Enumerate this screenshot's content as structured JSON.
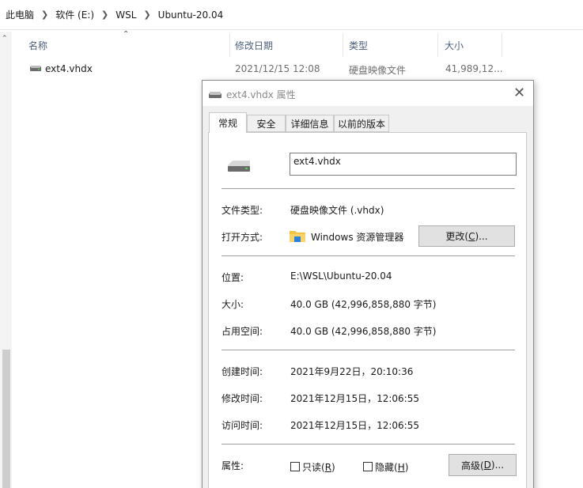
{
  "breadcrumb": [
    "此电脑",
    "软件 (E:)",
    "WSL",
    "Ubuntu-20.04"
  ],
  "list": {
    "columns": [
      "名称",
      "修改日期",
      "类型",
      "大小"
    ],
    "file": {
      "name": "ext4.vhdx",
      "modified": "2021/12/15 12:08",
      "type": "硬盘映像文件",
      "size": "41,989,12..."
    }
  },
  "dialog": {
    "title": "ext4.vhdx 属性",
    "tabs": [
      "常规",
      "安全",
      "详细信息",
      "以前的版本"
    ],
    "filename": "ext4.vhdx",
    "file_type_label": "文件类型:",
    "file_type_value": "硬盘映像文件 (.vhdx)",
    "open_with_label": "打开方式:",
    "open_with_value": "Windows 资源管理器",
    "change_button": {
      "text": "更改(",
      "key": "C",
      "rest": ")..."
    },
    "location_label": "位置:",
    "location_value": "E:\\WSL\\Ubuntu-20.04",
    "size_label": "大小:",
    "size_value": "40.0 GB (42,996,858,880 字节)",
    "disk_size_label": "占用空间:",
    "disk_size_value": "40.0 GB (42,996,858,880 字节)",
    "created_label": "创建时间:",
    "created_value": "2021年9月22日，20:10:36",
    "modified_label": "修改时间:",
    "modified_value": "2021年12月15日，12:06:55",
    "accessed_label": "访问时间:",
    "accessed_value": "2021年12月15日，12:06:55",
    "attributes_label": "属性:",
    "readonly": {
      "text": "只读(",
      "key": "R",
      "rest": ")"
    },
    "hidden": {
      "text": "隐藏(",
      "key": "H",
      "rest": ")"
    },
    "advanced_button": {
      "text": "高级(",
      "key": "D",
      "rest": ")..."
    }
  },
  "icons": {
    "close": "close-icon",
    "drive": "drive-icon",
    "folder": "folder-icon"
  },
  "colors": {
    "header_text": "#4c607a",
    "folder_yellow": "#f5c242",
    "folder_blue": "#2f7fd6"
  }
}
